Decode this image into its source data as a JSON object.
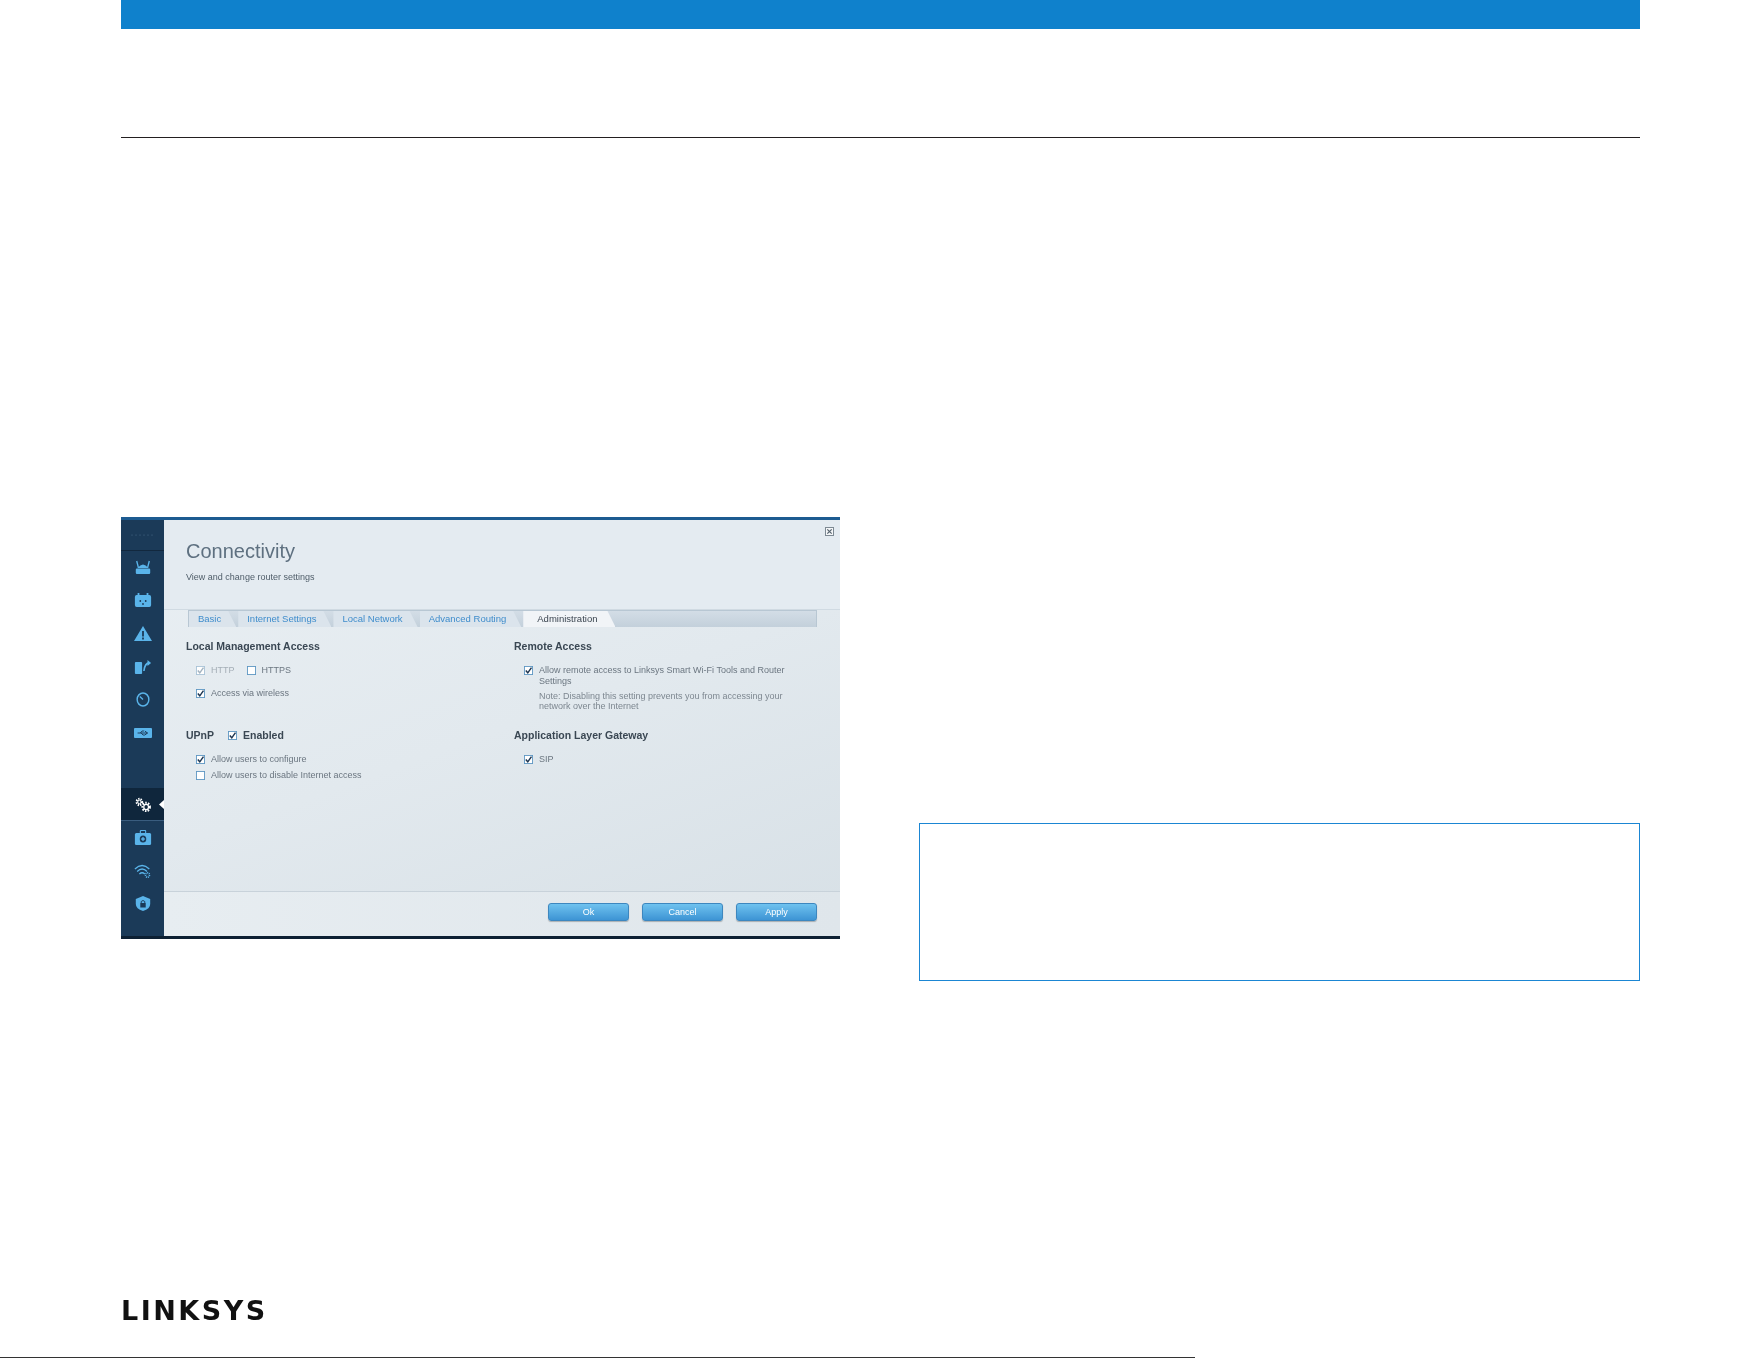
{
  "screenshot": {
    "sidebar": {
      "groups": [
        [
          {
            "selected": false
          },
          {
            "selected": false
          },
          {
            "selected": false
          },
          {
            "selected": false
          },
          {
            "selected": false
          },
          {
            "selected": false
          }
        ],
        [
          {
            "selected": true
          },
          {
            "selected": false
          },
          {
            "selected": false
          },
          {
            "selected": false
          }
        ]
      ]
    },
    "title": "Connectivity",
    "subtitle": "View and change router settings",
    "tabs": [
      {
        "label": "Basic",
        "selected": false
      },
      {
        "label": "Internet Settings",
        "selected": false
      },
      {
        "label": "Local Network",
        "selected": false
      },
      {
        "label": "Advanced Routing",
        "selected": false
      },
      {
        "label": "Administration",
        "selected": true
      }
    ],
    "sections": [
      {
        "heading": "Local Management Access",
        "rows": [
          [
            {
              "label": "HTTP",
              "checked": true,
              "disabled": true
            },
            {
              "label": "HTTPS",
              "checked": false,
              "disabled": false
            }
          ],
          [
            {
              "label": "Access via wireless",
              "checked": true,
              "disabled": false
            }
          ]
        ]
      },
      {
        "heading": "Remote Access",
        "rows": [
          [
            {
              "label": "Allow remote access to Linksys Smart Wi-Fi Tools and Router Settings",
              "checked": true,
              "disabled": false
            }
          ]
        ],
        "note": "Note: Disabling this setting prevents you from accessing your network over the Internet"
      },
      {
        "heading": "UPnP",
        "toggle": {
          "label": "Enabled",
          "checked": true
        },
        "rows": [
          [
            {
              "label": "Allow users to configure",
              "checked": true,
              "disabled": false
            }
          ],
          [
            {
              "label": "Allow users to disable Internet access",
              "checked": false,
              "disabled": false
            }
          ]
        ]
      },
      {
        "heading": "Application Layer Gateway",
        "rows": [
          [
            {
              "label": "SIP",
              "checked": true,
              "disabled": false
            }
          ]
        ]
      }
    ],
    "buttons": [
      "Ok",
      "Cancel",
      "Apply"
    ]
  },
  "logo": "LINKSYS"
}
